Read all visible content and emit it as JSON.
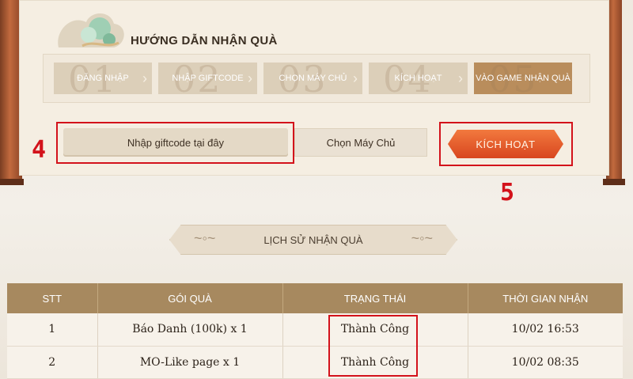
{
  "guide": {
    "title": "HƯỚNG DẪN NHẬN QUÀ",
    "steps": [
      {
        "num": "01",
        "label": "ĐĂNG NHẬP"
      },
      {
        "num": "02",
        "label": "NHẬP GIFTCODE"
      },
      {
        "num": "03",
        "label": "CHỌN MÁY CHỦ"
      },
      {
        "num": "04",
        "label": "KÍCH HOẠT"
      },
      {
        "num": "05",
        "label": "VÀO GAME NHẬN QUÀ"
      }
    ]
  },
  "form": {
    "code_placeholder": "Nhập giftcode tại đây",
    "server_label": "Chọn Máy Chủ",
    "activate_label": "KÍCH HOẠT"
  },
  "markers": {
    "input": "4",
    "activate": "5"
  },
  "history": {
    "title": "LỊCH SỬ NHẬN QUÀ",
    "columns": [
      "STT",
      "GÓI QUÀ",
      "TRẠNG THÁI",
      "THỜI GIAN NHẬN"
    ],
    "rows": [
      {
        "stt": "1",
        "gift": "Báo Danh (100k) x 1",
        "status": "Thành Công",
        "time": "10/02 16:53"
      },
      {
        "stt": "2",
        "gift": "MO-Like page x 1",
        "status": "Thành Công",
        "time": "10/02 08:35"
      }
    ]
  },
  "colors": {
    "accent": "#d8461f",
    "table_header": "#a7895f",
    "highlight": "#d3121b"
  }
}
